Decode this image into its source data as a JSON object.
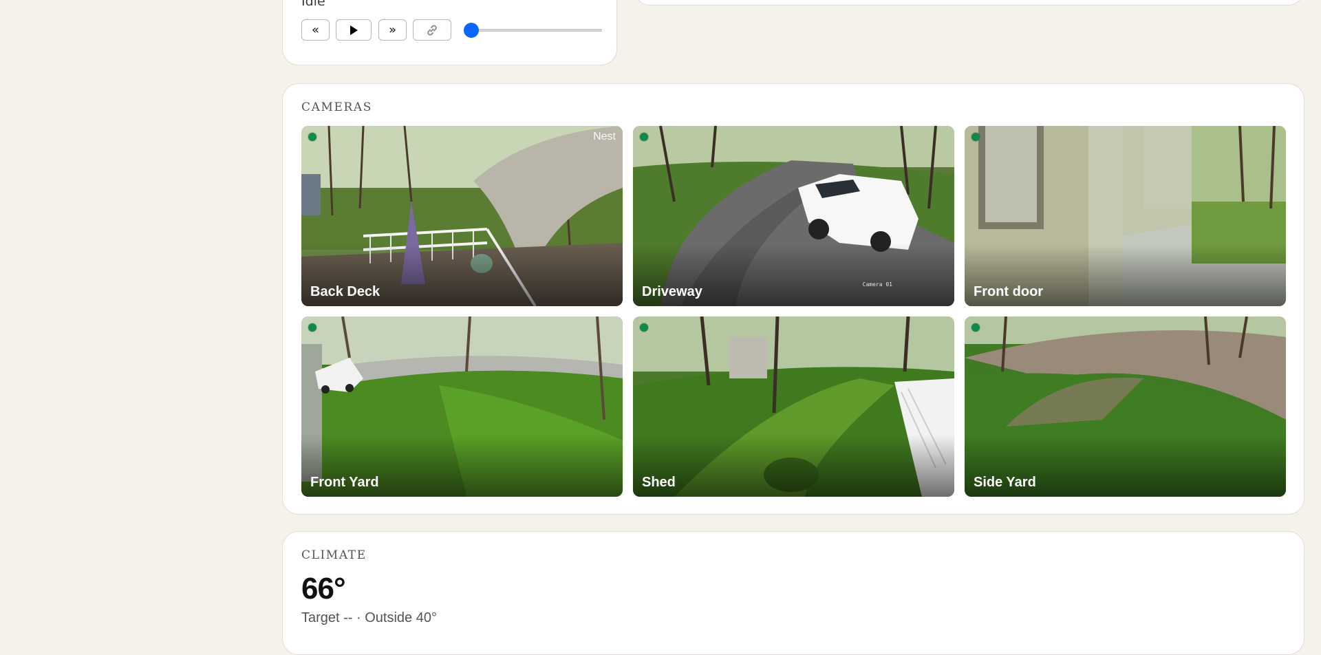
{
  "media": {
    "status": "Idle",
    "prev_label": "«",
    "play_label": "▶",
    "next_label": "»",
    "link_icon": "link-icon",
    "seek_position": 0
  },
  "cameras": {
    "title": "CAMERAS",
    "items": [
      {
        "name": "Back Deck",
        "badge": "Nest",
        "status_color": "#0f8a4a"
      },
      {
        "name": "Driveway",
        "status_color": "#0f8a4a",
        "overlay": "Camera 01"
      },
      {
        "name": "Front door",
        "status_color": "#0f8a4a"
      },
      {
        "name": "Front Yard",
        "status_color": "#0f8a4a"
      },
      {
        "name": "Shed",
        "status_color": "#0f8a4a"
      },
      {
        "name": "Side Yard",
        "status_color": "#0f8a4a"
      }
    ]
  },
  "climate": {
    "title": "CLIMATE",
    "temperature": "66°",
    "subtitle": "Target -- · Outside 40°"
  },
  "colors": {
    "accent": "#0a66ff",
    "online": "#0f8a4a",
    "background": "#f5f1eb"
  }
}
